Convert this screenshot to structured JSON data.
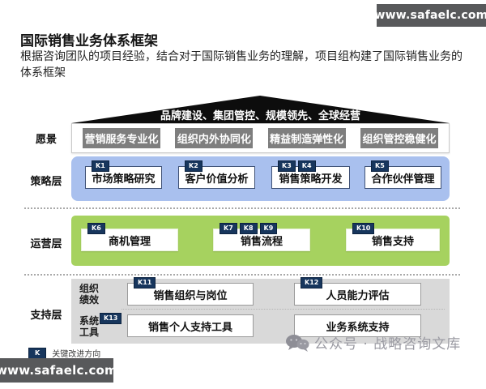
{
  "site": {
    "top_right": "www.safaelc.com",
    "bottom_left": "www.safaelc.com"
  },
  "header": {
    "title": "国际销售业务体系框架",
    "subtitle": "根据咨询团队的项目经验，结合对于国际销售业务的理解，项目组构建了国际销售业务的体系框架"
  },
  "diagram": {
    "roof_text": "品牌建设、集团管控、规模领先、全球经营",
    "layers": {
      "vision": {
        "label": "愿景",
        "items": [
          "营销服务专业化",
          "组织内外协同化",
          "精益制造弹性化",
          "组织管控稳健化"
        ]
      },
      "strategy": {
        "label": "策略层",
        "items": [
          {
            "badges": [
              "K1"
            ],
            "text": "市场策略研究"
          },
          {
            "badges": [
              "K2"
            ],
            "text": "客户价值分析"
          },
          {
            "badges": [
              "K3",
              "K4"
            ],
            "text": "销售策略开发"
          },
          {
            "badges": [
              "K5"
            ],
            "text": "合作伙伴管理"
          }
        ]
      },
      "operations": {
        "label": "运营层",
        "items": [
          {
            "badges": [
              "K6"
            ],
            "text": "商机管理"
          },
          {
            "badges": [
              "K7",
              "K8",
              "K9"
            ],
            "text": "销售流程"
          },
          {
            "badges": [
              "K10"
            ],
            "text": "销售支持"
          }
        ]
      },
      "support": {
        "label": "支持层",
        "rows": [
          {
            "sublabel": "组织绩效",
            "items": [
              {
                "badges": [
                  "K11"
                ],
                "text": "销售组织与岗位"
              },
              {
                "badges": [
                  "K12"
                ],
                "text": "人员能力评估"
              }
            ]
          },
          {
            "sublabel": "系统工具",
            "items": [
              {
                "badges": [
                  "K13"
                ],
                "text": "销售个人支持工具"
              },
              {
                "badges": [],
                "text": "业务系统支持"
              }
            ]
          }
        ]
      }
    },
    "legend": {
      "badge": "K",
      "text": "关键改进方向"
    }
  },
  "watermark": {
    "text": "公众号 · 战略咨询文库"
  },
  "colors": {
    "badge_navy": "#17365d",
    "strategy_panel_blue": "#a9c0ee",
    "operations_panel_green": "#a6d25f",
    "support_panel_gray": "#d9d9d9",
    "vision_box_gray": "#7e7e7e",
    "roof_black": "#0d0d0d",
    "site_tag_gray": "#58595b"
  }
}
